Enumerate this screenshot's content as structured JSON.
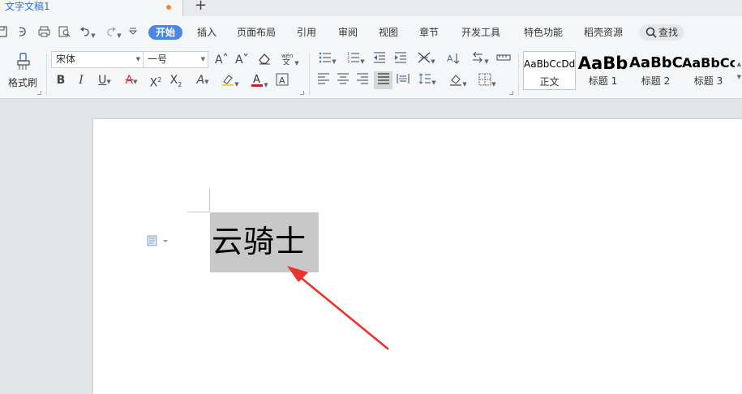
{
  "tabbar": {
    "doc_title": "文字文稿1",
    "add_tab": "+"
  },
  "menu": {
    "items": [
      "开始",
      "插入",
      "页面布局",
      "引用",
      "审阅",
      "视图",
      "章节",
      "开发工具",
      "特色功能",
      "稻壳资源"
    ],
    "search_label": "查找"
  },
  "ribbon": {
    "format_painter_label": "格式刷",
    "font_name": "宋体",
    "font_size": "一号",
    "styles": [
      {
        "preview": "AaBbCcDd",
        "name": "正文"
      },
      {
        "preview": "AaBb",
        "name": "标题 1"
      },
      {
        "preview": "AaBbC",
        "name": "标题 2"
      },
      {
        "preview": "AaBbCc",
        "name": "标题 3"
      }
    ]
  },
  "document": {
    "text": "云骑士"
  },
  "colors": {
    "accent": "#4a88e8",
    "modified_dot": "#f08c3a",
    "selection": "#c8c8c8",
    "annotation_arrow": "#e8342b"
  }
}
